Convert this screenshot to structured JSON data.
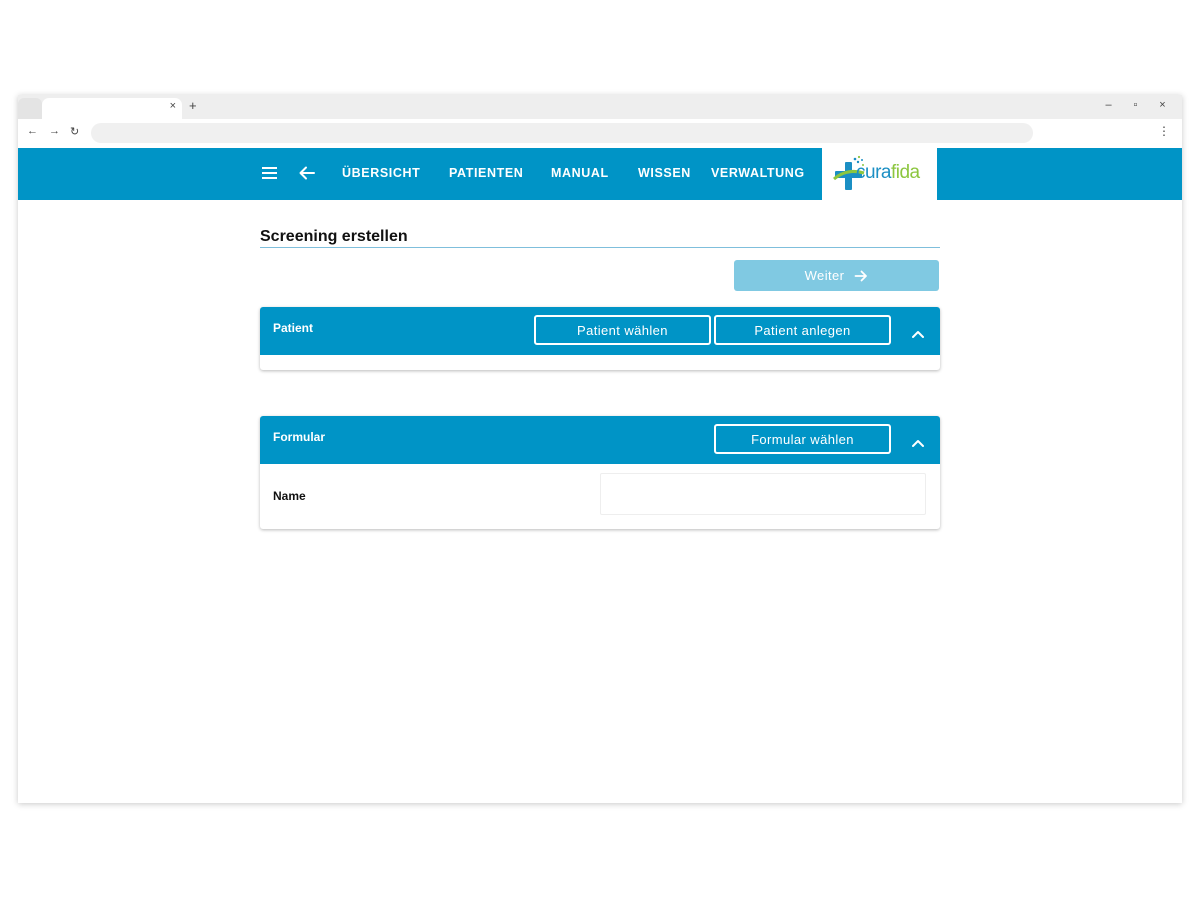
{
  "browser": {
    "tab_close": "×",
    "new_tab": "+",
    "window_controls": [
      "–",
      "▫",
      "×"
    ],
    "nav": {
      "back": "←",
      "forward": "→",
      "reload": "↻"
    },
    "menu": "⋮"
  },
  "header": {
    "menu_icon": "hamburger-icon",
    "back_icon": "arrow-left-icon",
    "nav_items": [
      "ÜBERSICHT",
      "PATIENTEN",
      "MANUAL",
      "WISSEN",
      "VERWALTUNG"
    ],
    "logo": {
      "part1": "cura",
      "part2": "fida"
    },
    "colors": {
      "bar": "#0094c6",
      "logo_blue": "#1b8fc4",
      "logo_green": "#8cc63f"
    }
  },
  "main": {
    "title": "Screening erstellen",
    "next_button": {
      "label": "Weiter",
      "icon": "arrow-right-icon"
    },
    "patient_section": {
      "title": "Patient",
      "choose_label": "Patient wählen",
      "create_label": "Patient anlegen",
      "toggle_icon": "chevron-up-icon"
    },
    "form_section": {
      "title": "Formular",
      "choose_label": "Formular wählen",
      "toggle_icon": "chevron-up-icon",
      "fields": [
        {
          "label": "Name",
          "value": ""
        }
      ]
    }
  }
}
